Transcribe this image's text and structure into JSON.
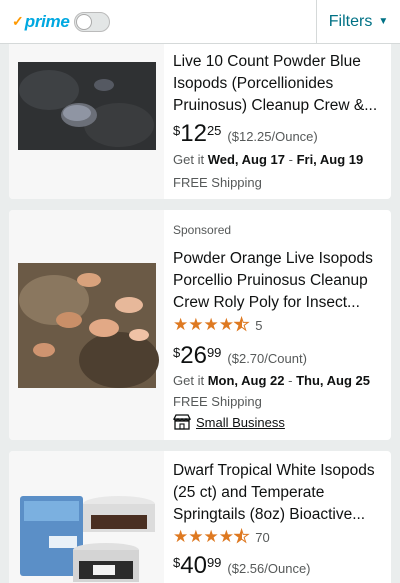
{
  "topbar": {
    "prime_check": "✓",
    "prime_label": "prime",
    "filters_label": "Filters",
    "filters_chevron": "▼"
  },
  "results": [
    {
      "title": "Live 10 Count Powder Blue Isopods (Porcellionides Pruinosus) Cleanup Crew &...",
      "price_symbol": "$",
      "price_whole": "12",
      "price_fraction": "25",
      "unit_price": "($12.25/Ounce)",
      "delivery_prefix": "Get it",
      "delivery_start": "Wed, Aug 17",
      "delivery_sep": " - ",
      "delivery_end": "Fri, Aug 19",
      "shipping": "FREE Shipping",
      "image_icon": "isopod-photo"
    },
    {
      "sponsored": "Sponsored",
      "title": "Powder Orange Live Isopods Porcellio Pruinosus Cleanup Crew Roly Poly for Insect...",
      "rating": 4.5,
      "review_count": "5",
      "price_symbol": "$",
      "price_whole": "26",
      "price_fraction": "99",
      "unit_price": "($2.70/Count)",
      "delivery_prefix": "Get it",
      "delivery_start": "Mon, Aug 22",
      "delivery_sep": " - ",
      "delivery_end": "Thu, Aug 25",
      "shipping": "FREE Shipping",
      "small_business": "Small Business",
      "image_icon": "isopod-photo"
    },
    {
      "title": "Dwarf Tropical White Isopods (25 ct) and Temperate Springtails (8oz) Bioactive...",
      "rating": 4.5,
      "review_count": "70",
      "price_symbol": "$",
      "price_whole": "40",
      "price_fraction": "99",
      "unit_price": "($2.56/Ounce)",
      "image_icon": "isopod-kit-photo"
    }
  ],
  "colors": {
    "prime_blue": "#00a8e1",
    "prime_orange": "#ff9900",
    "link_teal": "#007185",
    "star_orange": "#de7921",
    "page_bg": "#eaeded"
  }
}
